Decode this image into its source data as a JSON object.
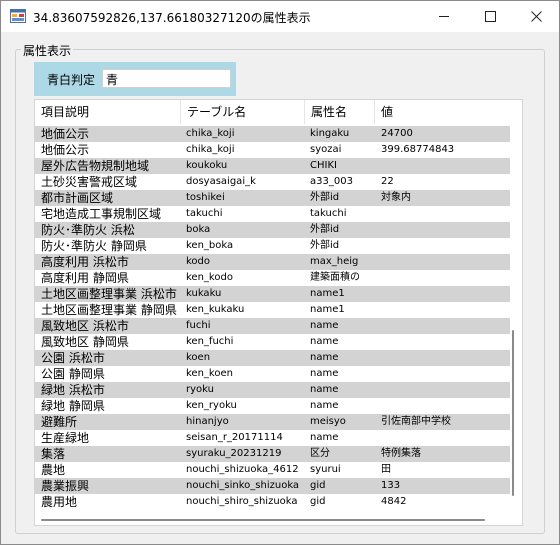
{
  "window": {
    "title": "34.83607592826,137.66180327120の属性表示"
  },
  "group": {
    "title": "属性表示"
  },
  "filter": {
    "label": "青白判定",
    "value": "青"
  },
  "table": {
    "columns": [
      "項目説明",
      "テーブル名",
      "属性名",
      "値"
    ],
    "rows": [
      {
        "desc": "地価公示",
        "table": "chika_koji",
        "attr": "kingaku",
        "value": "24700",
        "alt": true
      },
      {
        "desc": "地価公示",
        "table": "chika_koji",
        "attr": "syozai",
        "value": "399.68774843",
        "alt": false
      },
      {
        "desc": "屋外広告物規制地域",
        "table": "koukoku",
        "attr": "CHIKI",
        "value": "",
        "alt": true
      },
      {
        "desc": "土砂災害警戒区域",
        "table": "dosyasaigai_k",
        "attr": "a33_003",
        "value": "22",
        "alt": false
      },
      {
        "desc": "都市計画区域",
        "table": "toshikei",
        "attr": "外部id",
        "value": "対象内",
        "alt": true
      },
      {
        "desc": "宅地造成工事規制区域",
        "table": "takuchi",
        "attr": "takuchi",
        "value": "",
        "alt": false
      },
      {
        "desc": "防火･準防火 浜松",
        "table": "boka",
        "attr": "外部id",
        "value": "",
        "alt": true
      },
      {
        "desc": "防火･準防火 静岡県",
        "table": "ken_boka",
        "attr": "外部id",
        "value": "",
        "alt": false
      },
      {
        "desc": "高度利用 浜松市",
        "table": "kodo",
        "attr": "max_heig",
        "value": "",
        "alt": true
      },
      {
        "desc": "高度利用 静岡県",
        "table": "ken_kodo",
        "attr": "建築面積の",
        "value": "",
        "alt": false
      },
      {
        "desc": "土地区画整理事業 浜松市",
        "table": "kukaku",
        "attr": "name1",
        "value": "",
        "alt": true
      },
      {
        "desc": "土地区画整理事業 静岡県",
        "table": "ken_kukaku",
        "attr": "name1",
        "value": "",
        "alt": false
      },
      {
        "desc": "風致地区 浜松市",
        "table": "fuchi",
        "attr": "name",
        "value": "",
        "alt": true
      },
      {
        "desc": "風致地区 静岡県",
        "table": "ken_fuchi",
        "attr": "name",
        "value": "",
        "alt": false
      },
      {
        "desc": "公園 浜松市",
        "table": "koen",
        "attr": "name",
        "value": "",
        "alt": true
      },
      {
        "desc": "公園 静岡県",
        "table": "ken_koen",
        "attr": "name",
        "value": "",
        "alt": false
      },
      {
        "desc": "緑地 浜松市",
        "table": "ryoku",
        "attr": "name",
        "value": "",
        "alt": true
      },
      {
        "desc": "緑地 静岡県",
        "table": "ken_ryoku",
        "attr": "name",
        "value": "",
        "alt": false
      },
      {
        "desc": "避難所",
        "table": "hinanjyo",
        "attr": "meisyo",
        "value": "引佐南部中学校",
        "alt": true
      },
      {
        "desc": "生産緑地",
        "table": "seisan_r_20171114",
        "attr": "name",
        "value": "",
        "alt": false
      },
      {
        "desc": "集落",
        "table": "syuraku_20231219",
        "attr": "区分",
        "value": "特例集落",
        "alt": true
      },
      {
        "desc": "農地",
        "table": "nouchi_shizuoka_4612",
        "attr": "syurui",
        "value": "田",
        "alt": false
      },
      {
        "desc": "農業振興",
        "table": "nouchi_sinko_shizuoka",
        "attr": "gid",
        "value": "133",
        "alt": true
      },
      {
        "desc": "農用地",
        "table": "nouchi_shiro_shizuoka",
        "attr": "gid",
        "value": "4842",
        "alt": false
      }
    ]
  }
}
